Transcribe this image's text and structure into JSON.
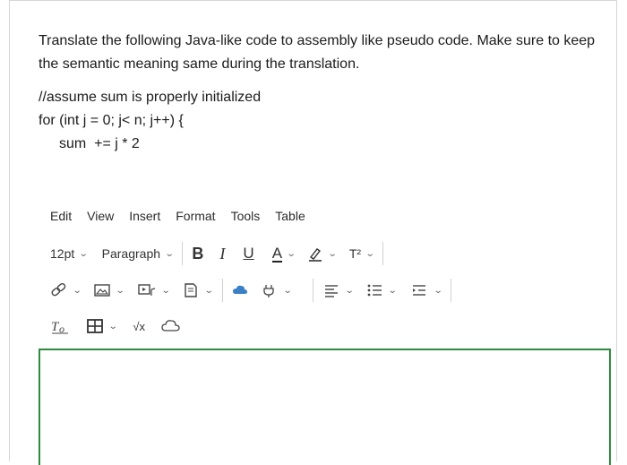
{
  "question": {
    "text": "Translate the following Java-like code to assembly like pseudo code. Make sure to keep the semantic meaning same during the translation."
  },
  "code": {
    "lines": [
      "//assume sum is properly initialized",
      "for (int j = 0; j< n; j++) {",
      "sum  += j * 2"
    ]
  },
  "menu": {
    "items": [
      "Edit",
      "View",
      "Insert",
      "Format",
      "Tools",
      "Table"
    ]
  },
  "toolbar": {
    "font_size": "12pt",
    "block_format": "Paragraph",
    "bold": "B",
    "italic": "I",
    "underline": "U",
    "text_color": "A",
    "superscript": "T²",
    "math": "√x"
  },
  "colors": {
    "editor_border": "#2f8a3e",
    "toolbar_blue": "#3b7fc4"
  }
}
